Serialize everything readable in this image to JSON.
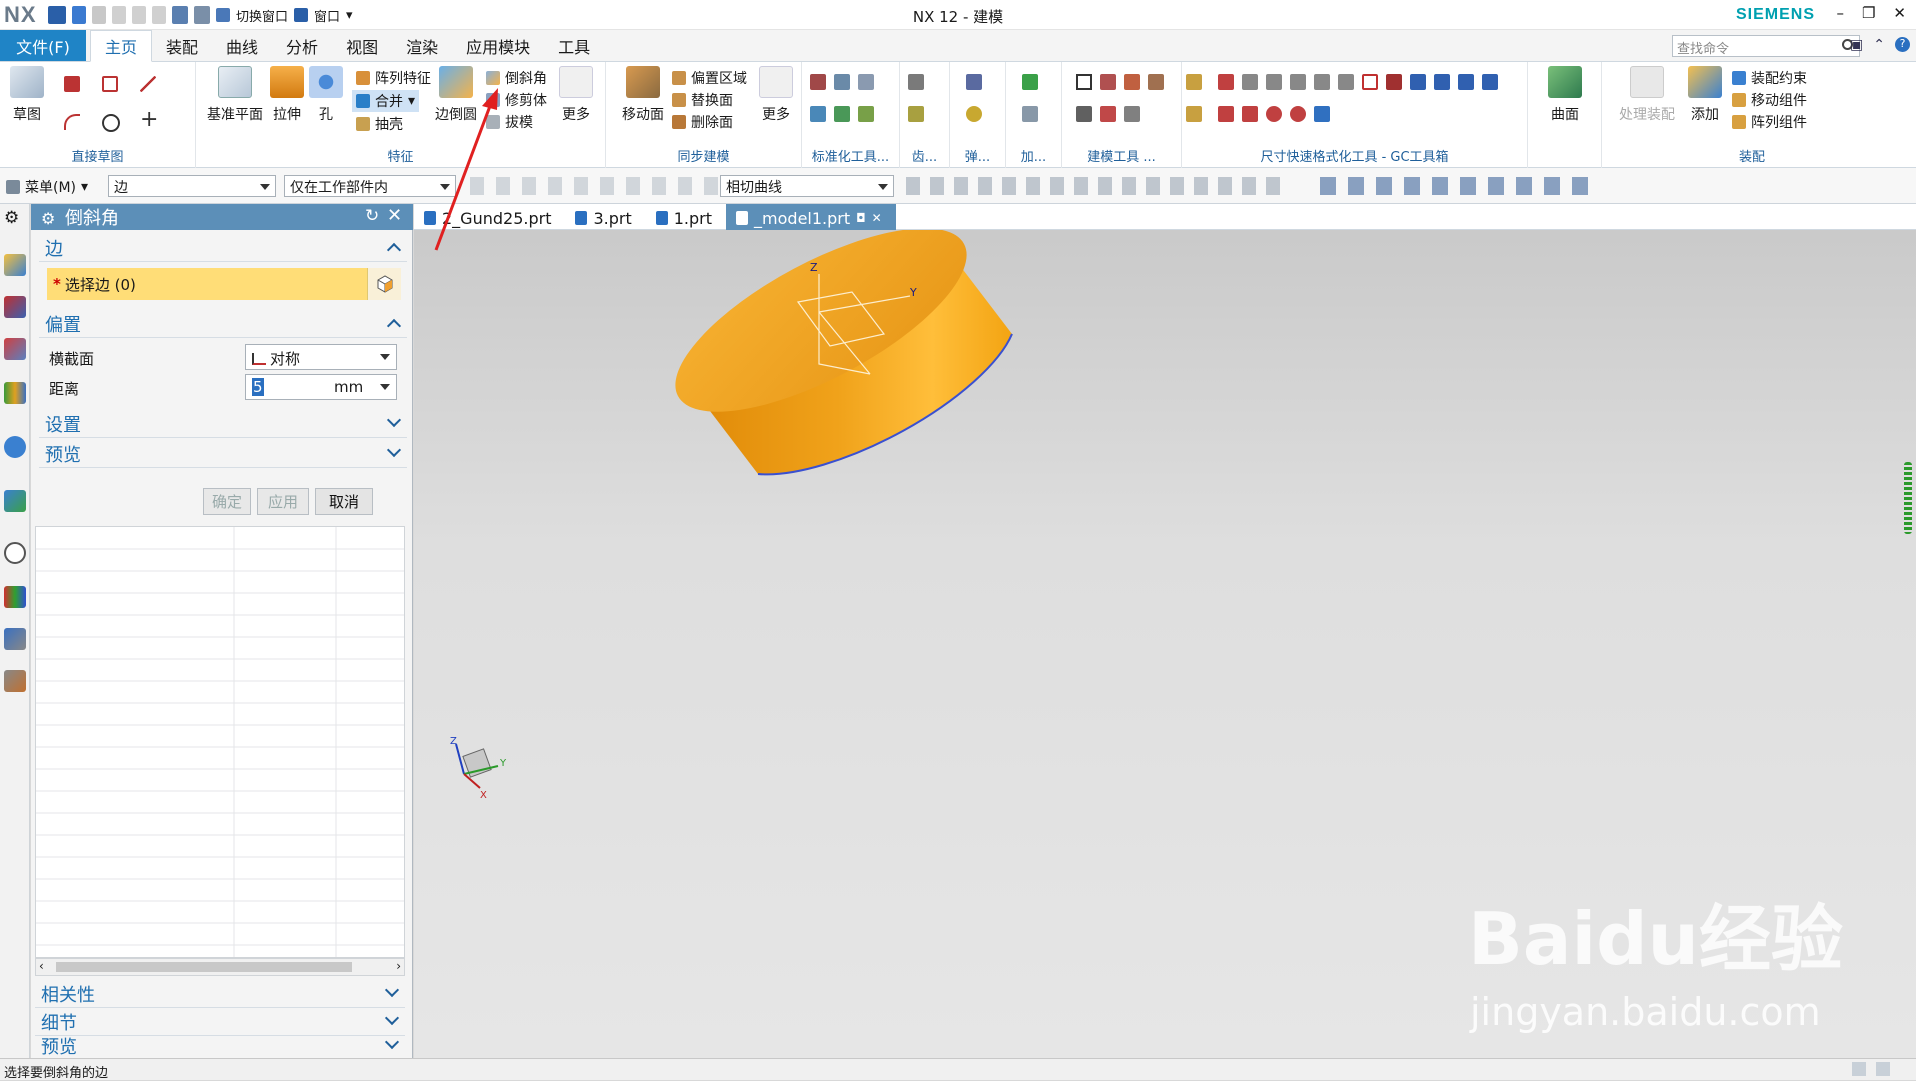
{
  "app": {
    "logo": "NX",
    "window_title": "NX 12 - 建模",
    "brand": "SIEMENS",
    "quick_access": {
      "switch_window": "切换窗口",
      "window": "窗口"
    }
  },
  "menubar": {
    "file": "文件(F)",
    "tabs": [
      "主页",
      "装配",
      "曲线",
      "分析",
      "视图",
      "渲染",
      "应用模块",
      "工具"
    ],
    "active_tab": "主页",
    "search_placeholder": "查找命令"
  },
  "ribbon": {
    "sketch": {
      "sketch": "草图",
      "group": "直接草图"
    },
    "feature": {
      "datum_plane": "基准平面",
      "extrude": "拉伸",
      "hole": "孔",
      "pattern_feature": "阵列特征",
      "unite": "合并",
      "shell": "抽壳",
      "edge_blend": "边倒圆",
      "chamfer": "倒斜角",
      "trim_body": "修剪体",
      "draft": "拔模",
      "more": "更多",
      "group": "特征"
    },
    "sync": {
      "move_face": "移动面",
      "offset_region": "偏置区域",
      "replace_face": "替换面",
      "delete_face": "删除面",
      "more": "更多",
      "group": "同步建模"
    },
    "groups_mid": [
      "标准化工具...",
      "齿...",
      "弹...",
      "加...",
      "建模工具 ...",
      "尺寸快速格式化工具 - GC工具箱"
    ],
    "surface": {
      "surface": "曲面"
    },
    "assembly": {
      "process_assy": "处理装配",
      "add": "添加",
      "assy_constraint": "装配约束",
      "move_component": "移动组件",
      "pattern_component": "阵列组件",
      "group": "装配"
    }
  },
  "toolbar2": {
    "menu": "菜单(M)",
    "filter": "边",
    "scope": "仅在工作部件内",
    "curve_rule": "相切曲线"
  },
  "dialog": {
    "title": "倒斜角",
    "edge_section": "边",
    "select_edge": "选择边 (0)",
    "offset_section": "偏置",
    "cross_section_label": "横截面",
    "cross_section_value": "对称",
    "distance_label": "距离",
    "distance_value": "5",
    "distance_unit": "mm",
    "settings_section": "设置",
    "preview_section": "预览",
    "ok": "确定",
    "apply": "应用",
    "cancel": "取消",
    "bottom_sections": [
      "相关性",
      "细节",
      "预览"
    ]
  },
  "doc_tabs": [
    "2_Gund25.prt",
    "3.prt",
    "1.prt",
    "_model1.prt"
  ],
  "active_doc": "_model1.prt",
  "viewport": {
    "axis_x": "X",
    "axis_y": "Y",
    "axis_z": "Z",
    "body_color": "#f5a20f"
  },
  "status": "选择要倒斜角的边",
  "watermark": {
    "brand": "Baidu经验",
    "url": "jingyan.baidu.com"
  },
  "colors": {
    "accent": "#1f84c6",
    "dialog_header": "#5c8fb8",
    "selection": "#ffdd77",
    "annotation_arrow": "#e02020"
  }
}
